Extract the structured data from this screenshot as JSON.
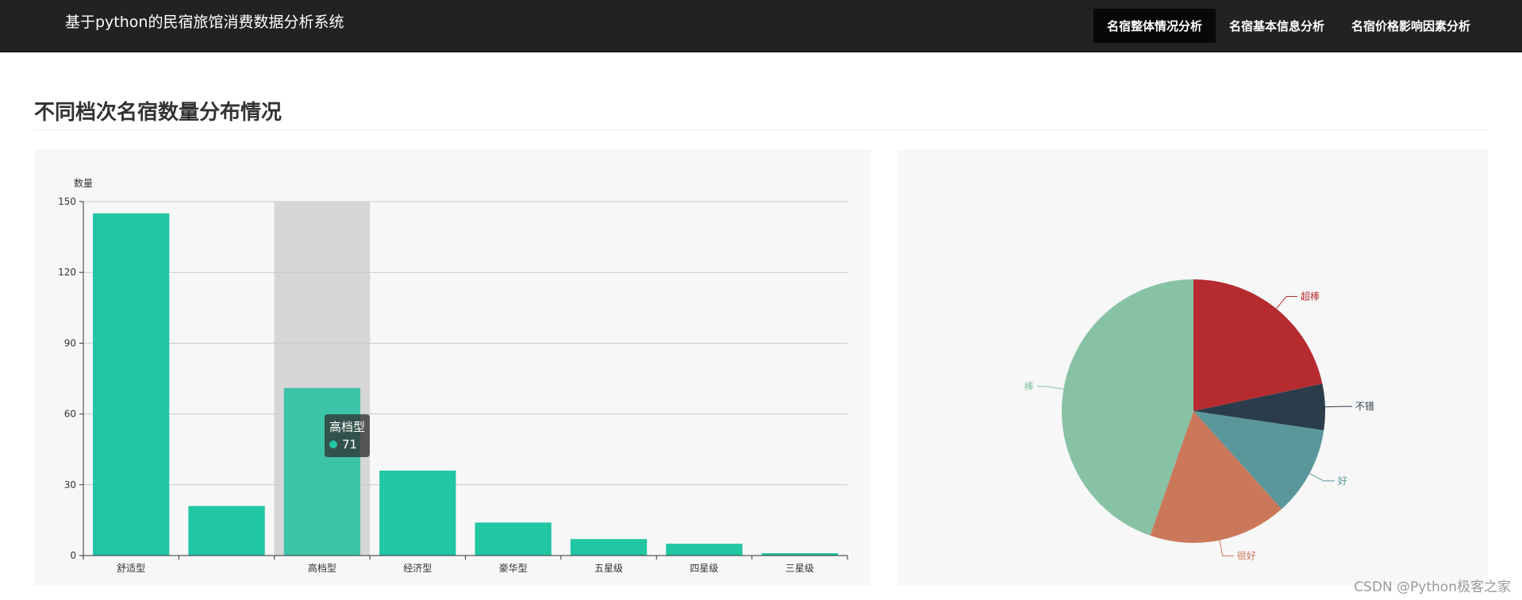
{
  "app": {
    "title": "基于python的民宿旅馆消费数据分析系统"
  },
  "nav": {
    "items": [
      {
        "label": "名宿整体情况分析",
        "active": true
      },
      {
        "label": "名宿基本信息分析",
        "active": false
      },
      {
        "label": "名宿价格影响因素分析",
        "active": false
      }
    ]
  },
  "section": {
    "title": "不同档次名宿数量分布情况"
  },
  "colors": {
    "navbar": "#222222",
    "bar": "#21c6a3",
    "bar_highlight": "#3cc3a8",
    "axis_pointer": "#d6d6d6"
  },
  "chart_data": [
    {
      "type": "bar",
      "ylabel": "数量",
      "ylim": [
        0,
        150
      ],
      "yticks": [
        0,
        30,
        60,
        90,
        120,
        150
      ],
      "grid": true,
      "categories": [
        "舒适型",
        "",
        "高档型",
        "经济型",
        "豪华型",
        "五星级",
        "四星级",
        "三星级"
      ],
      "values": [
        145,
        21,
        71,
        36,
        14,
        7,
        5,
        1
      ],
      "tooltip": {
        "category": "高档型",
        "value": "71"
      }
    },
    {
      "type": "pie",
      "slices": [
        {
          "label": "超棒",
          "value": 65,
          "color": "#b52b2f"
        },
        {
          "label": "不错",
          "value": 17,
          "color": "#2b3d4b"
        },
        {
          "label": "好",
          "value": 33,
          "color": "#5a979b"
        },
        {
          "label": "很好",
          "value": 51,
          "color": "#cb775a"
        },
        {
          "label": "棒",
          "value": 134,
          "color": "#87c2a4"
        }
      ]
    }
  ],
  "watermark": "CSDN @Python极客之家"
}
